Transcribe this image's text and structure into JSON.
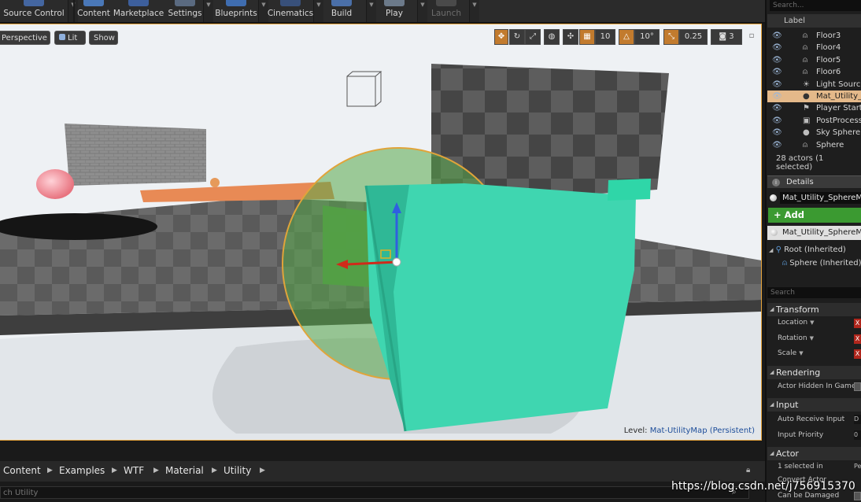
{
  "toolbar": {
    "items": [
      "Source Control",
      "Content",
      "Marketplace",
      "Settings",
      "Blueprints",
      "Cinematics",
      "Build",
      "Play",
      "Launch"
    ]
  },
  "viewport": {
    "perspective": "Perspective",
    "lit": "Lit",
    "show": "Show",
    "grid_snap": "10",
    "rotation_snap": "10°",
    "scale_snap": "0.25",
    "camera_speed": "3",
    "level_prefix": "Level:",
    "level_name": "Mat-UtilityMap (Persistent)"
  },
  "content_browser": {
    "crumbs": [
      "Content",
      "Examples",
      "WTF",
      "Material",
      "Utility"
    ],
    "search_text": "ch Utility"
  },
  "watermark": "https://blog.csdn.net/j756915370",
  "outliner": {
    "search_placeholder": "Search...",
    "column_label": "Label",
    "rows": [
      {
        "name": "Floor3",
        "icon": "figure-icon"
      },
      {
        "name": "Floor4",
        "icon": "figure-icon"
      },
      {
        "name": "Floor5",
        "icon": "figure-icon"
      },
      {
        "name": "Floor6",
        "icon": "figure-icon"
      },
      {
        "name": "Light Source",
        "icon": "sun-icon"
      },
      {
        "name": "Mat_Utility_S",
        "icon": "sphere-icon",
        "selected": true
      },
      {
        "name": "Player Start",
        "icon": "flag-icon"
      },
      {
        "name": "PostProcess",
        "icon": "postprocess-icon"
      },
      {
        "name": "Sky Sphere",
        "icon": "sphere-icon"
      },
      {
        "name": "Sphere",
        "icon": "figure-icon"
      }
    ],
    "actor_count": "28 actors (1 selected)"
  },
  "details": {
    "tab_label": "Details",
    "name_value": "Mat_Utility_SphereMa",
    "add_component": "+ Add Component",
    "component_name": "Mat_Utility_SphereMas",
    "tree_root": "Root (Inherited)",
    "tree_child": "Sphere (Inherited)",
    "search_placeholder": "Search",
    "transform": {
      "title": "Transform",
      "location": "Location",
      "rotation": "Rotation",
      "scale": "Scale",
      "x": "X"
    },
    "rendering": {
      "title": "Rendering",
      "hidden_in_game": "Actor Hidden In Game"
    },
    "input": {
      "title": "Input",
      "auto_receive": "Auto Receive Input",
      "auto_receive_value": "D",
      "priority": "Input Priority",
      "priority_value": "0"
    },
    "actor": {
      "title": "Actor",
      "selected_in": "1 selected in",
      "selected_in_value": "Pe",
      "convert": "Convert Actor",
      "damaged": "Can be Damaged"
    }
  },
  "colors": {
    "selection": "#e4b98a",
    "add_component": "#3b9a31",
    "gizmo_sphere": "#e0a43a",
    "teal_mesh": "#3fd6b0"
  }
}
